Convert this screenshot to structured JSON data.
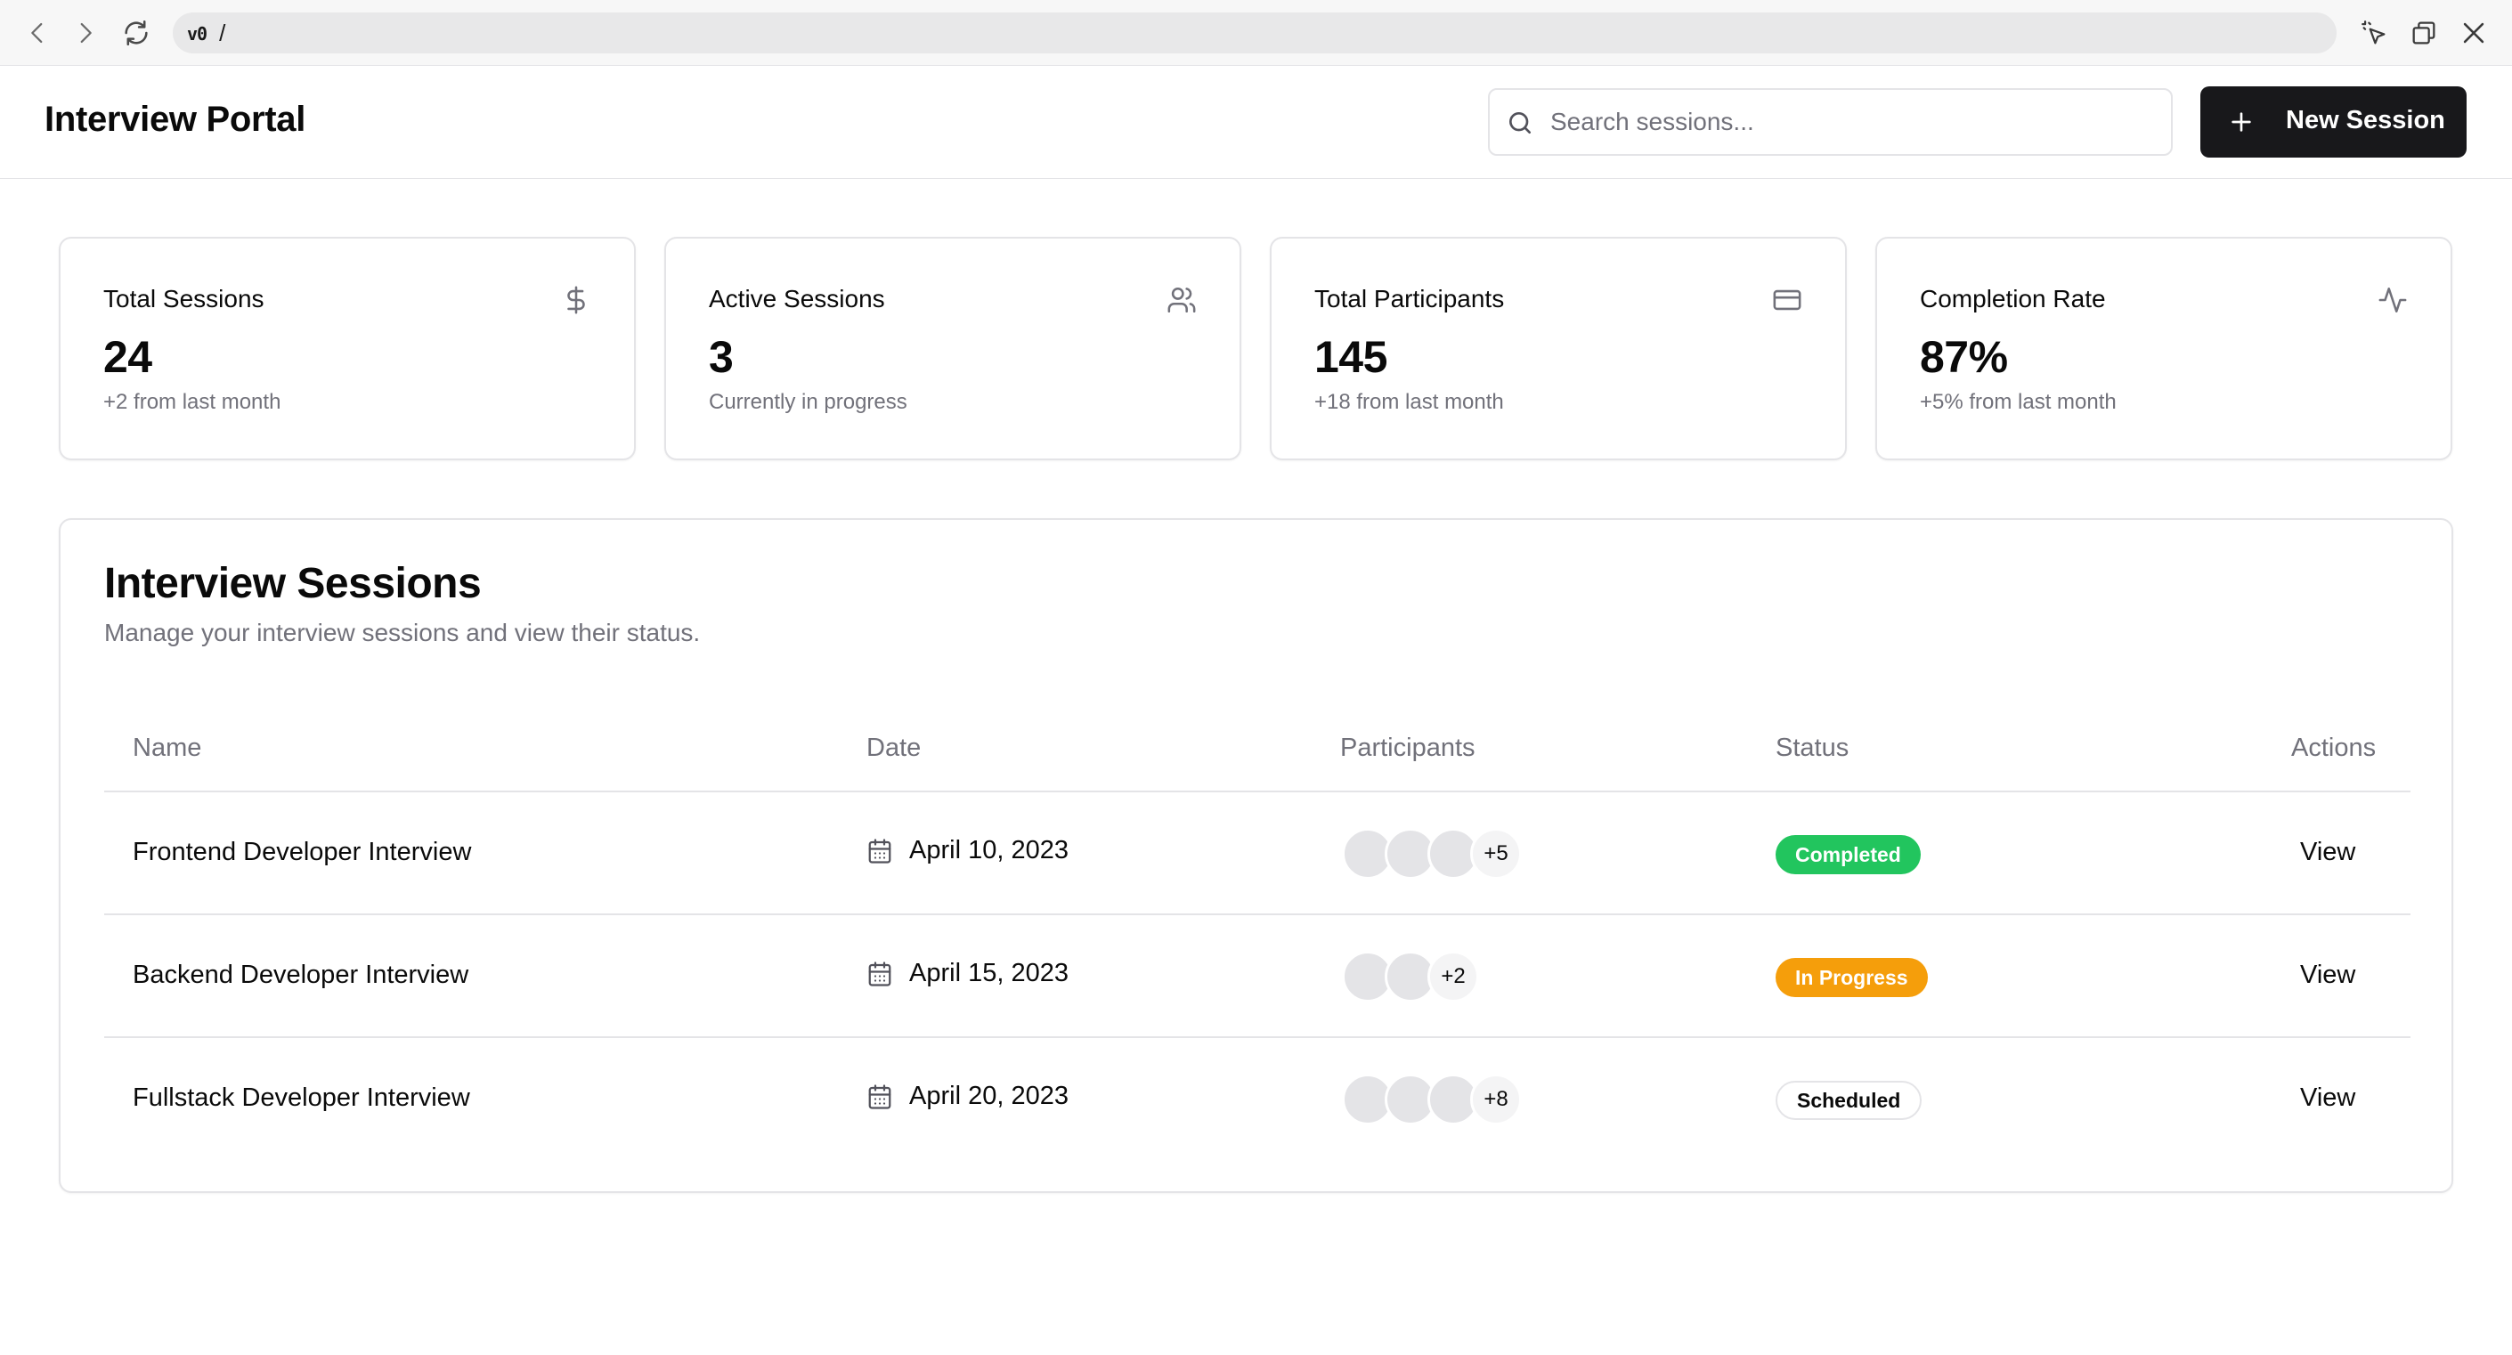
{
  "browser": {
    "address_prefix": "v0",
    "address_path": "/"
  },
  "header": {
    "title": "Interview Portal",
    "search_placeholder": "Search sessions...",
    "new_session_label": "New Session"
  },
  "stats": [
    {
      "title": "Total Sessions",
      "value": "24",
      "sub": "+2 from last month",
      "icon": "dollar-sign-icon"
    },
    {
      "title": "Active Sessions",
      "value": "3",
      "sub": "Currently in progress",
      "icon": "users-icon"
    },
    {
      "title": "Total Participants",
      "value": "145",
      "sub": "+18 from last month",
      "icon": "credit-card-icon"
    },
    {
      "title": "Completion Rate",
      "value": "87%",
      "sub": "+5% from last month",
      "icon": "activity-icon"
    }
  ],
  "sessions": {
    "title": "Interview Sessions",
    "description": "Manage your interview sessions and view their status.",
    "columns": [
      "Name",
      "Date",
      "Participants",
      "Status",
      "Actions"
    ],
    "rows": [
      {
        "name": "Frontend Developer Interview",
        "date": "April 10, 2023",
        "avatar_count": 3,
        "more": "+5",
        "status": "Completed",
        "status_key": "completed",
        "action": "View"
      },
      {
        "name": "Backend Developer Interview",
        "date": "April 15, 2023",
        "avatar_count": 2,
        "more": "+2",
        "status": "In Progress",
        "status_key": "in-progress",
        "action": "View"
      },
      {
        "name": "Fullstack Developer Interview",
        "date": "April 20, 2023",
        "avatar_count": 3,
        "more": "+8",
        "status": "Scheduled",
        "status_key": "scheduled",
        "action": "View"
      }
    ]
  },
  "colors": {
    "primary": "#18181b",
    "muted_text": "#71717a",
    "border": "#e4e4e7",
    "completed": "#22c55e",
    "in_progress": "#f59e0b"
  }
}
